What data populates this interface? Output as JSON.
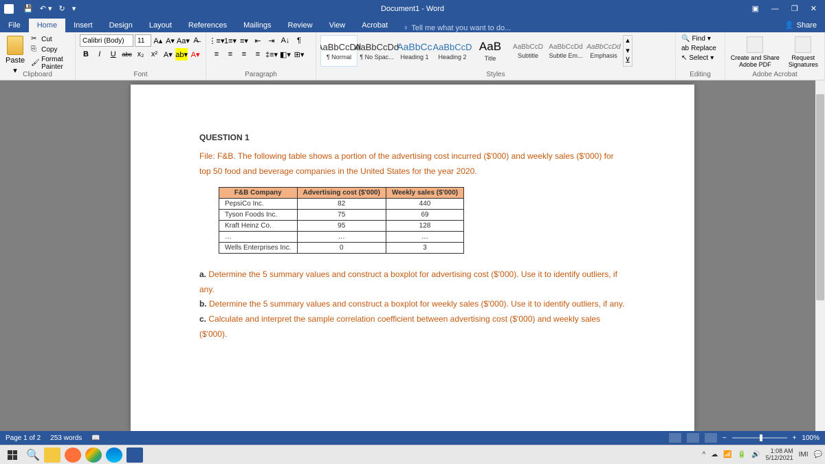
{
  "titlebar": {
    "title": "Document1 - Word"
  },
  "tabs": {
    "file": "File",
    "home": "Home",
    "insert": "Insert",
    "design": "Design",
    "layout": "Layout",
    "references": "References",
    "mailings": "Mailings",
    "review": "Review",
    "view": "View",
    "acrobat": "Acrobat",
    "tellme": "Tell me what you want to do...",
    "share": "Share"
  },
  "ribbon": {
    "clipboard": {
      "label": "Clipboard",
      "paste": "Paste",
      "cut": "Cut",
      "copy": "Copy",
      "painter": "Format Painter"
    },
    "font": {
      "label": "Font",
      "name": "Calibri (Body)",
      "size": "11"
    },
    "paragraph": {
      "label": "Paragraph"
    },
    "styles": {
      "label": "Styles",
      "items": [
        {
          "preview": "AaBbCcDd",
          "name": "¶ Normal"
        },
        {
          "preview": "AaBbCcDd",
          "name": "¶ No Spac..."
        },
        {
          "preview": "AaBbCc",
          "name": "Heading 1"
        },
        {
          "preview": "AaBbCcD",
          "name": "Heading 2"
        },
        {
          "preview": "AaB",
          "name": "Title"
        },
        {
          "preview": "AaBbCcD",
          "name": "Subtitle"
        },
        {
          "preview": "AaBbCcDd",
          "name": "Subtle Em..."
        },
        {
          "preview": "AaBbCcDd",
          "name": "Emphasis"
        }
      ]
    },
    "editing": {
      "label": "Editing",
      "find": "Find",
      "replace": "Replace",
      "select": "Select"
    },
    "adobe": {
      "label": "Adobe Acrobat",
      "create": "Create and Share Adobe PDF",
      "request": "Request Signatures"
    }
  },
  "doc": {
    "q_title": "QUESTION 1",
    "intro": "File: F&B. The following table shows a portion of the advertising cost incurred ($'000) and weekly sales ($'000) for top 50 food and beverage companies in the United States for the year 2020.",
    "table": {
      "headers": [
        "F&B Company",
        "Advertising cost ($'000)",
        "Weekly sales ($'000)"
      ],
      "rows": [
        [
          "PepsiCo Inc.",
          "82",
          "440"
        ],
        [
          "Tyson Foods Inc.",
          "75",
          "69"
        ],
        [
          "Kraft Heinz Co.",
          "95",
          "128"
        ],
        [
          "…",
          "…",
          "…"
        ],
        [
          "Wells Enterprises Inc.",
          "0",
          "3"
        ]
      ]
    },
    "qa_label": "a.",
    "qa": "Determine the 5 summary values and construct a boxplot for advertising cost ($'000). Use it to identify outliers, if any.",
    "qb_label": "b.",
    "qb": "Determine the 5 summary values and construct a boxplot for weekly sales ($'000). Use it to identify outliers, if any.",
    "qc_label": "c.",
    "qc": "Calculate and interpret the sample correlation coefficient between advertising cost ($'000) and weekly sales ($'000)."
  },
  "statusbar": {
    "page": "Page 1 of 2",
    "words": "253 words",
    "zoom": "100%"
  },
  "tray": {
    "time": "1:08 AM",
    "date": "5/12/2021"
  }
}
